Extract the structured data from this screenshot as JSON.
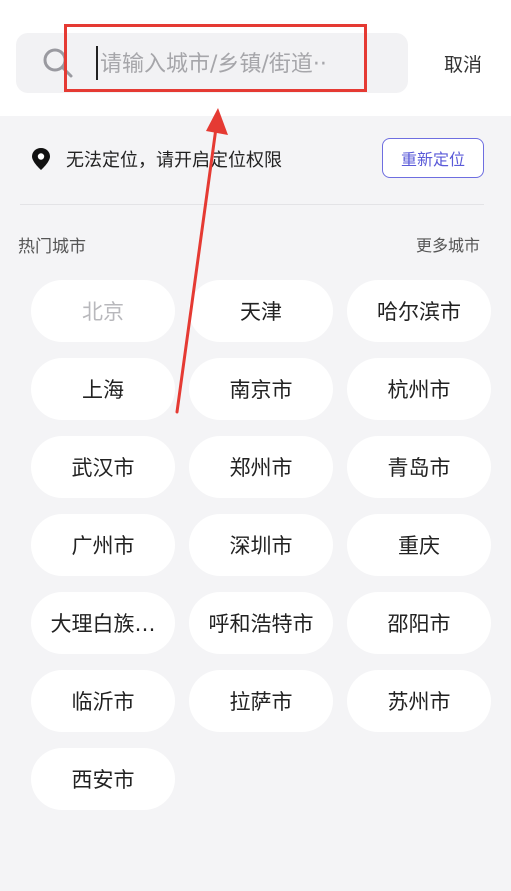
{
  "search": {
    "placeholder": "请输入城市/乡镇/街道··",
    "value": "",
    "cancel_label": "取消"
  },
  "location": {
    "status_text": "无法定位，请开启定位权限",
    "relocate_label": "重新定位"
  },
  "hot_cities": {
    "title": "热门城市",
    "more_label": "更多城市",
    "items": [
      {
        "label": "北京",
        "disabled": true
      },
      {
        "label": "天津",
        "disabled": false
      },
      {
        "label": "哈尔滨市",
        "disabled": false
      },
      {
        "label": "上海",
        "disabled": false
      },
      {
        "label": "南京市",
        "disabled": false
      },
      {
        "label": "杭州市",
        "disabled": false
      },
      {
        "label": "武汉市",
        "disabled": false
      },
      {
        "label": "郑州市",
        "disabled": false
      },
      {
        "label": "青岛市",
        "disabled": false
      },
      {
        "label": "广州市",
        "disabled": false
      },
      {
        "label": "深圳市",
        "disabled": false
      },
      {
        "label": "重庆",
        "disabled": false
      },
      {
        "label": "大理白族…",
        "disabled": false
      },
      {
        "label": "呼和浩特市",
        "disabled": false
      },
      {
        "label": "邵阳市",
        "disabled": false
      },
      {
        "label": "临沂市",
        "disabled": false
      },
      {
        "label": "拉萨市",
        "disabled": false
      },
      {
        "label": "苏州市",
        "disabled": false
      },
      {
        "label": "西安市",
        "disabled": false
      }
    ]
  },
  "colors": {
    "accent": "#5a5ad8",
    "annotation": "#e53a33"
  }
}
